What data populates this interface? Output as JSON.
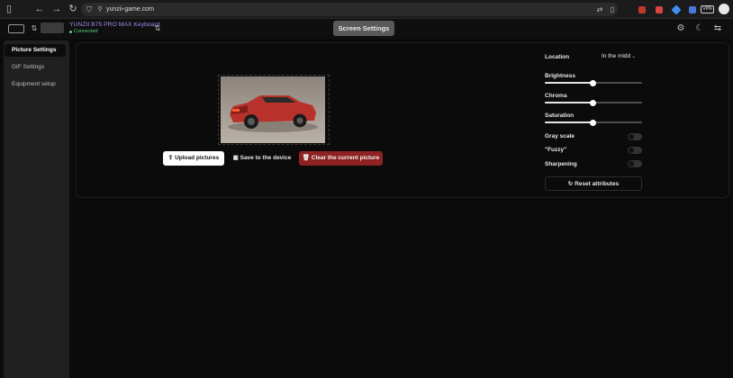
{
  "browser": {
    "url": "yunzii-game.com",
    "vpn_badge": "VPN"
  },
  "device": {
    "name": "YUNZII B75 PRO MAX Keyboard",
    "status": "Connected"
  },
  "header": {
    "screen_settings_label": "Screen Settings"
  },
  "sidebar": {
    "items": [
      {
        "label": "Picture Settings",
        "active": true
      },
      {
        "label": "GIF Settings",
        "active": false
      },
      {
        "label": "Equipment setup",
        "active": false
      }
    ]
  },
  "actions": {
    "upload_label": "Upload pictures",
    "save_label": "Save to the device",
    "clear_label": "Clear the current picture"
  },
  "settings": {
    "location_label": "Location",
    "location_value": "In the midd",
    "brightness_label": "Brightness",
    "brightness_value": 0.5,
    "chroma_label": "Chroma",
    "chroma_value": 0.5,
    "saturation_label": "Saturation",
    "saturation_value": 0.5,
    "grayscale_label": "Gray scale",
    "grayscale_on": false,
    "fuzzy_label": "\"Fuzzy\"",
    "fuzzy_on": false,
    "sharpening_label": "Sharpening",
    "sharpening_on": false,
    "reset_label": "Reset attributes"
  },
  "colors": {
    "accent_red": "#8e2222",
    "device_name": "#9f8cf0",
    "connected": "#56d37a"
  }
}
